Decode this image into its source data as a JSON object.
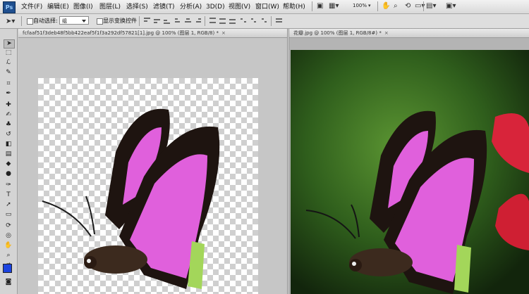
{
  "app": {
    "logo": "Ps"
  },
  "menu": [
    {
      "label": "文件(F)"
    },
    {
      "label": "编辑(E)"
    },
    {
      "label": "图像(I)"
    },
    {
      "label": "图层(L)"
    },
    {
      "label": "选择(S)"
    },
    {
      "label": "滤镜(T)"
    },
    {
      "label": "分析(A)"
    },
    {
      "label": "3D(D)"
    },
    {
      "label": "视图(V)"
    },
    {
      "label": "窗口(W)"
    },
    {
      "label": "帮助(H)"
    }
  ],
  "appbar": {
    "zoom": "100%"
  },
  "options": {
    "auto_select_label": "自动选择:",
    "auto_select_value": "组",
    "show_transform_label": "显示变换控件"
  },
  "documents": [
    {
      "title": "fcfaaf51f3deb48f5bb422eaf5f1f3a292df57821[1].jpg @ 100% (图层 1, RGB/8) *",
      "close": "×",
      "background": "transparent"
    },
    {
      "title": "花瓣.jpg @ 100% (图层 1, RGB/8#) *",
      "close": "×",
      "background": "green-bokeh"
    }
  ],
  "colors": {
    "foreground": "#1b43e0",
    "background": "#ffffff",
    "wing_pink": "#e060dc",
    "wing_dark": "#1e1410",
    "wing_green": "#a3d65a",
    "bokeh_green": "#4d8a2a"
  },
  "tools": [
    "move-tool",
    "marquee-tool",
    "lasso-tool",
    "quick-select-tool",
    "crop-tool",
    "eyedropper-tool",
    "healing-tool",
    "brush-tool",
    "clone-stamp-tool",
    "history-brush-tool",
    "eraser-tool",
    "gradient-tool",
    "blur-tool",
    "dodge-tool",
    "pen-tool",
    "type-tool",
    "path-select-tool",
    "shape-tool",
    "3d-rotate-tool",
    "3d-orbit-tool",
    "hand-tool",
    "zoom-tool"
  ]
}
